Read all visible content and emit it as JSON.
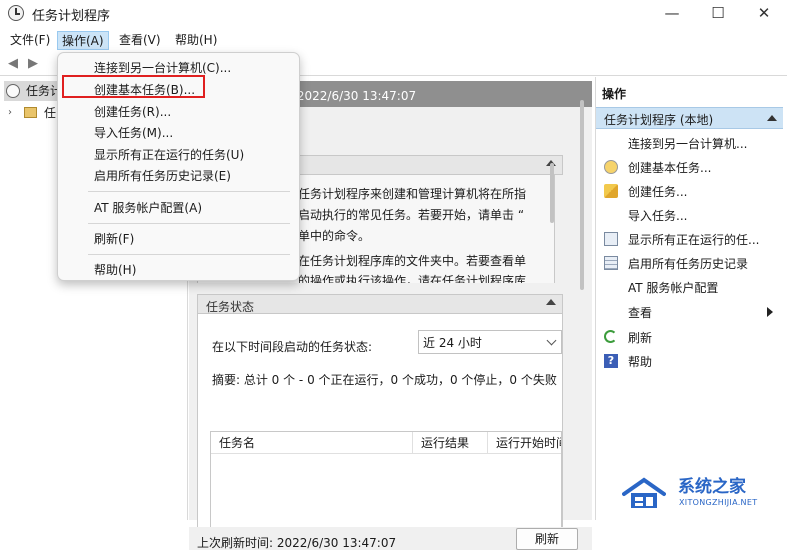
{
  "window": {
    "title": "任务计划程序",
    "minimize": "—",
    "maximize": "☐",
    "close": "✕"
  },
  "menubar": {
    "file": "文件(F)",
    "action": "操作(A)",
    "view": "查看(V)",
    "help": "帮助(H)"
  },
  "tree": {
    "root_label": "任务计",
    "child_label": "任"
  },
  "center": {
    "header": "次刷新时间: 2022/6/30 13:47:07",
    "overview_lines": [
      "任务计划程序来创建和管理计算机将在所指",
      "启动执行的常见任务。若要开始，请单击 “",
      "单中的命令。",
      "",
      "在任务计划程序库的文件夹中。若要查看单",
      "的操作或执行该操作，请在任务计划程序库"
    ],
    "status_section_label": "任务状态",
    "status_label": "在以下时间段启动的任务状态:",
    "range_value": "近 24 小时",
    "summary": "摘要: 总计 0 个 - 0 个正在运行，0 个成功，0 个停止，0 个失败",
    "table_headers": [
      "任务名",
      "运行结果",
      "运行开始时间"
    ],
    "last_refresh": "上次刷新时间: 2022/6/30 13:47:07",
    "refresh_button": "刷新"
  },
  "actions": {
    "title": "操作",
    "group_label": "任务计划程序 (本地)",
    "items": [
      "连接到另一台计算机...",
      "创建基本任务...",
      "创建任务...",
      "导入任务...",
      "显示所有正在运行的任...",
      "启用所有任务历史记录",
      "AT 服务帐户配置",
      "查看",
      "刷新",
      "帮助"
    ]
  },
  "dropdown": {
    "items": [
      "连接到另一台计算机(C)...",
      "创建基本任务(B)...",
      "创建任务(R)...",
      "导入任务(M)...",
      "显示所有正在运行的任务(U)",
      "启用所有任务历史记录(E)",
      "AT 服务帐户配置(A)",
      "刷新(F)",
      "帮助(H)"
    ]
  },
  "watermark": {
    "name": "系统之家",
    "url": "XITONGZHIJIA.NET"
  },
  "colors": {
    "highlight_border": "#e02020",
    "selected_menu": "#cce4f7",
    "header_gray": "#8f8f8f",
    "actions_group": "#cde3f5",
    "watermark_blue": "#2a66c6"
  }
}
